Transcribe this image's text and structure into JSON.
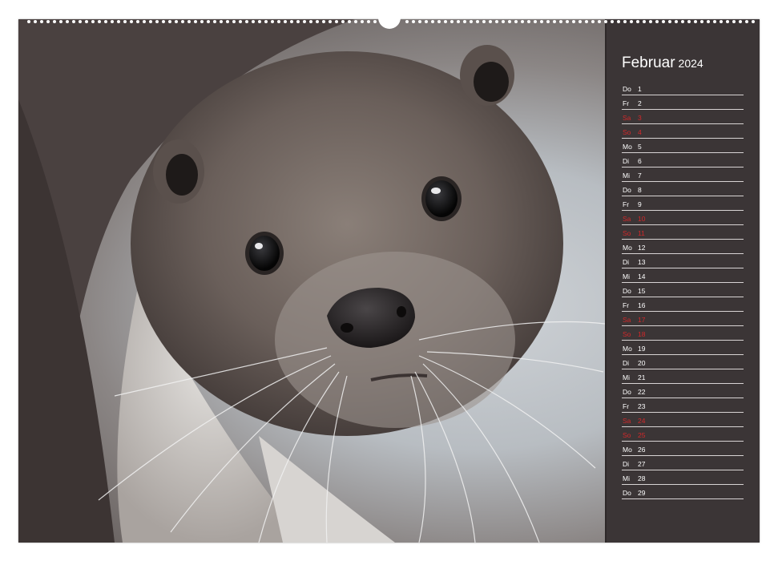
{
  "calendar": {
    "month": "Februar",
    "year": "2024",
    "colors": {
      "panel": "#3b3536",
      "weekend": "#d3282a",
      "text": "#ffffff"
    },
    "days": [
      {
        "name": "Do",
        "num": "1",
        "weekend": false
      },
      {
        "name": "Fr",
        "num": "2",
        "weekend": false
      },
      {
        "name": "Sa",
        "num": "3",
        "weekend": true
      },
      {
        "name": "So",
        "num": "4",
        "weekend": true
      },
      {
        "name": "Mo",
        "num": "5",
        "weekend": false
      },
      {
        "name": "Di",
        "num": "6",
        "weekend": false
      },
      {
        "name": "Mi",
        "num": "7",
        "weekend": false
      },
      {
        "name": "Do",
        "num": "8",
        "weekend": false
      },
      {
        "name": "Fr",
        "num": "9",
        "weekend": false
      },
      {
        "name": "Sa",
        "num": "10",
        "weekend": true
      },
      {
        "name": "So",
        "num": "11",
        "weekend": true
      },
      {
        "name": "Mo",
        "num": "12",
        "weekend": false
      },
      {
        "name": "Di",
        "num": "13",
        "weekend": false
      },
      {
        "name": "Mi",
        "num": "14",
        "weekend": false
      },
      {
        "name": "Do",
        "num": "15",
        "weekend": false
      },
      {
        "name": "Fr",
        "num": "16",
        "weekend": false
      },
      {
        "name": "Sa",
        "num": "17",
        "weekend": true
      },
      {
        "name": "So",
        "num": "18",
        "weekend": true
      },
      {
        "name": "Mo",
        "num": "19",
        "weekend": false
      },
      {
        "name": "Di",
        "num": "20",
        "weekend": false
      },
      {
        "name": "Mi",
        "num": "21",
        "weekend": false
      },
      {
        "name": "Do",
        "num": "22",
        "weekend": false
      },
      {
        "name": "Fr",
        "num": "23",
        "weekend": false
      },
      {
        "name": "Sa",
        "num": "24",
        "weekend": true
      },
      {
        "name": "So",
        "num": "25",
        "weekend": true
      },
      {
        "name": "Mo",
        "num": "26",
        "weekend": false
      },
      {
        "name": "Di",
        "num": "27",
        "weekend": false
      },
      {
        "name": "Mi",
        "num": "28",
        "weekend": false
      },
      {
        "name": "Do",
        "num": "29",
        "weekend": false
      }
    ]
  }
}
